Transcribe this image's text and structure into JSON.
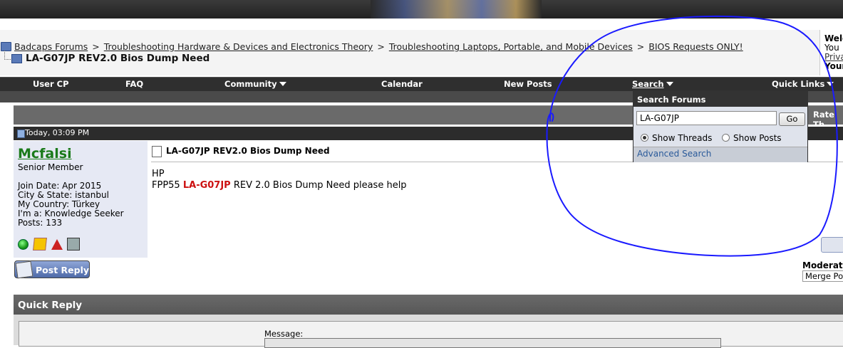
{
  "breadcrumb": {
    "items": [
      "Badcaps Forums",
      "Troubleshooting Hardware & Devices and Electronics Theory",
      "Troubleshooting Laptops, Portable, and Mobile Devices",
      "BIOS Requests ONLY!"
    ],
    "separator": ">",
    "current_thread": "LA-G07JP REV2.0 Bios Dump Need"
  },
  "welcome": {
    "line1": "Welc",
    "line2": "You",
    "line3": "Priva",
    "line4": "Your"
  },
  "navbar": {
    "items": [
      "User CP",
      "FAQ",
      "Community",
      "Calendar",
      "New Posts",
      "Search",
      "Quick Links"
    ]
  },
  "thread_header": {
    "rate_label": "Rate Th"
  },
  "post": {
    "date": "Today, 03:09 PM",
    "title": "LA-G07JP REV2.0 Bios Dump Need",
    "line1": "HP",
    "line2_prefix": "FPP55 ",
    "line2_highlight": "LA-G07JP",
    "line2_suffix": " REV 2.0 Bios Dump Need please help"
  },
  "user": {
    "name": "Mcfalsi",
    "title": "Senior Member",
    "join_date": "Join Date: Apr 2015",
    "city_state": "City & State: istanbul",
    "country": "My Country: Türkey",
    "im_a": "I'm a: Knowledge Seeker",
    "posts": "Posts: 133",
    "status_icons": [
      "online-icon",
      "reputation-icon",
      "warning-icon",
      "computer-icon"
    ]
  },
  "actions": {
    "post_reply": "Post Reply",
    "moderation_label": "Moderati",
    "merge_option": "Merge Po"
  },
  "quick_reply": {
    "title": "Quick Reply",
    "message_label": "Message:"
  },
  "search_dropdown": {
    "title": "Search Forums",
    "input_value": "LA-G07JP",
    "go_label": "Go",
    "option_threads": "Show Threads",
    "option_posts": "Show Posts",
    "selected": "Show Threads",
    "advanced_link": "Advanced Search"
  },
  "colors": {
    "navbar_bg": "#2f2f2f",
    "username": "#1a7a1a",
    "highlight_red": "#cc1111",
    "annotation_stroke": "#1a1aff",
    "link_blue": "#2a5a9a"
  }
}
